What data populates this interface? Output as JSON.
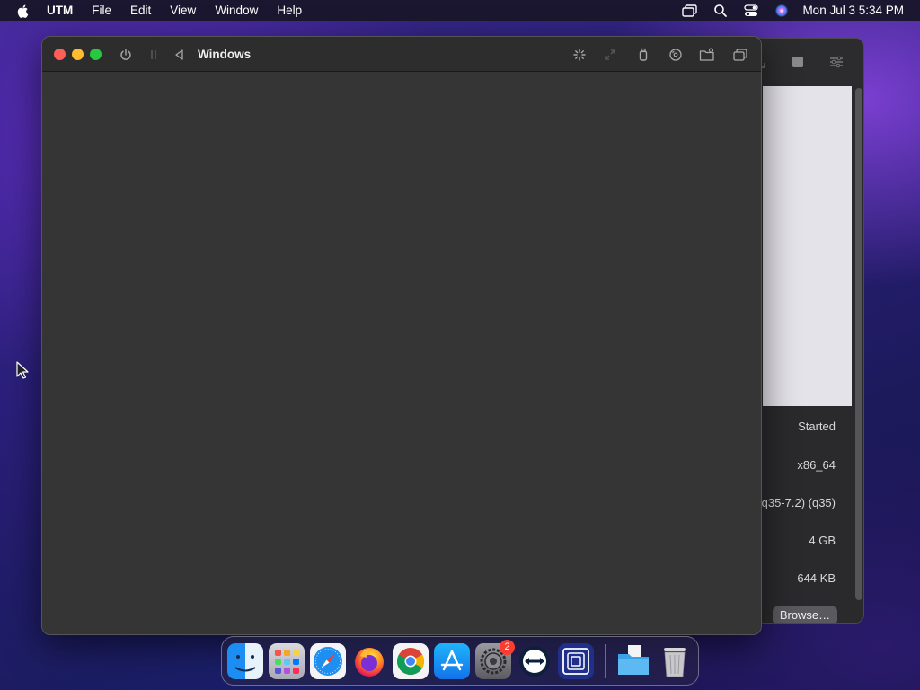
{
  "menubar": {
    "app_name": "UTM",
    "menus": [
      "File",
      "Edit",
      "View",
      "Window",
      "Help"
    ],
    "clock": "Mon Jul 3  5:34 PM",
    "icons": [
      "screen-mirroring-icon",
      "search-icon",
      "control-center-icon",
      "siri-icon"
    ]
  },
  "vm_window": {
    "title": "Windows",
    "toolbar_icons": [
      "power-icon",
      "pause-icon",
      "back-icon",
      "spinner-icon",
      "resize-icon",
      "usb-icon",
      "cd-icon",
      "shared-folder-icon",
      "windows-icon"
    ]
  },
  "library_window": {
    "status": "Started",
    "architecture": "x86_64",
    "machine": "(q35-7.2) (q35)",
    "memory": "4 GB",
    "size": "644 KB",
    "browse_label": "Browse…"
  },
  "dock": {
    "apps": [
      "Finder",
      "Launchpad",
      "Safari",
      "Firefox",
      "Chrome",
      "App Store",
      "System Settings",
      "TeamViewer",
      "Remote Desktop",
      "Downloads",
      "Trash"
    ],
    "settings_badge": "2"
  },
  "colors": {
    "close": "#ff5f57",
    "minimize": "#febc2e",
    "maximize": "#28c840",
    "window_bg": "#353535"
  }
}
